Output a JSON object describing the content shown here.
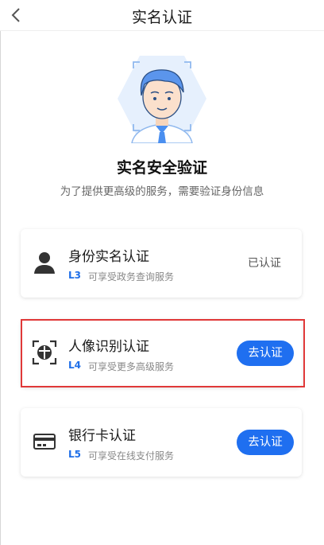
{
  "header": {
    "title": "实名认证"
  },
  "hero": {
    "title": "实名安全验证",
    "subtitle": "为了提供更高级的服务，需要验证身份信息"
  },
  "cards": [
    {
      "name": "身份实名认证",
      "level": "L3",
      "desc": "可享受政务查询服务",
      "status": "已认证",
      "icon": "person-icon"
    },
    {
      "name": "人像识别认证",
      "level": "L4",
      "desc": "可享受更多高级服务",
      "action": "去认证",
      "icon": "face-scan-icon"
    },
    {
      "name": "银行卡认证",
      "level": "L5",
      "desc": "可享受在线支付服务",
      "action": "去认证",
      "icon": "bank-card-icon"
    }
  ],
  "colors": {
    "accent": "#1f6ff0",
    "highlight": "#e03838",
    "hero_bg": "#e6f0fd"
  }
}
